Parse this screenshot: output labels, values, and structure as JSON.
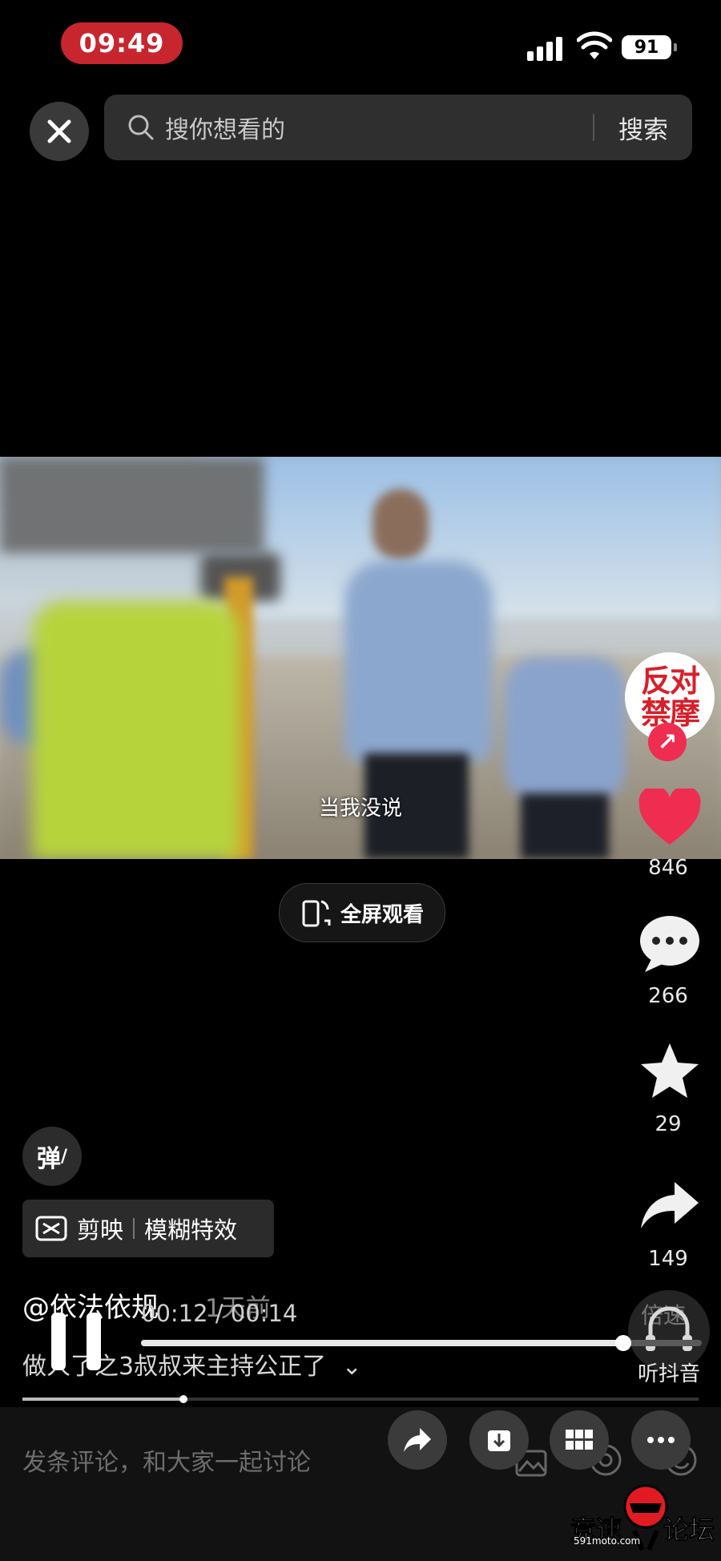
{
  "status_bar": {
    "time": "09:49",
    "battery": "91"
  },
  "search": {
    "placeholder": "搜你想看的",
    "button_label": "搜索"
  },
  "video": {
    "subtitle": "当我没说"
  },
  "creator": {
    "avatar_text": "反对\n禁摩",
    "follow_symbol": "↗"
  },
  "actions": {
    "likes": "846",
    "comments": "266",
    "favorites": "29",
    "shares": "149"
  },
  "fullscreen_label": "全屏观看",
  "danmaku_label": "弹",
  "effect_tag": {
    "app": "剪映",
    "effect": "模糊特效"
  },
  "post": {
    "author": "@依法依规",
    "posted": "1天前",
    "description": "做人了之3叔叔来主持公正了",
    "expand_symbol": "⌄"
  },
  "player": {
    "timecode": "00:12 / 00:14",
    "speed_label": "倍速",
    "progress": 0.86
  },
  "listen_label": "听抖音",
  "comment_input": {
    "placeholder": "发条评论，和大家一起讨论"
  },
  "watermark": {
    "text_left": "竞速",
    "text_right": "论坛",
    "url": "591moto.com"
  },
  "colors": {
    "like_red": "#ee2d51",
    "time_pill": "#c8262f",
    "brand_red": "#d81f2a"
  }
}
